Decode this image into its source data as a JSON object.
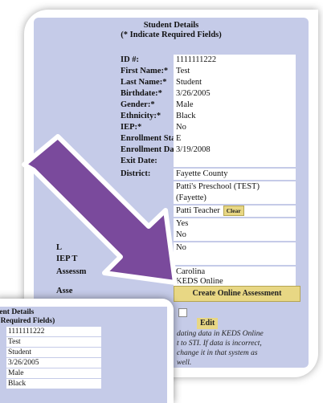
{
  "form": {
    "title": "Student Details",
    "subtitle": "(* Indicate Required Fields)",
    "rows": [
      {
        "label": "ID #:",
        "value": "1111111222"
      },
      {
        "label": "First Name:*",
        "value": "Test"
      },
      {
        "label": "Last Name:*",
        "value": "Student"
      },
      {
        "label": "Birthdate:*",
        "value": "3/26/2005"
      },
      {
        "label": "Gender:*",
        "value": "Male"
      },
      {
        "label": "Ethnicity:*",
        "value": "Black"
      },
      {
        "label": "IEP:*",
        "value": "No"
      },
      {
        "label": "Enrollment Status:*",
        "value": "E"
      },
      {
        "label": "Enrollment Date:*",
        "value": "3/19/2008"
      },
      {
        "label": "Exit Date:",
        "value": ""
      },
      {
        "label": "District:",
        "value": "Fayette County"
      },
      {
        "label": "",
        "value": "Patti's Preschool (TEST)"
      },
      {
        "label": "",
        "value": "(Fayette)"
      },
      {
        "label": "",
        "value": "Patti Teacher"
      },
      {
        "label": "",
        "value": "Yes"
      },
      {
        "label": "",
        "value": "No"
      },
      {
        "label": "L",
        "value": "No"
      },
      {
        "label": "IEP T",
        "value": ""
      },
      {
        "label": "Assessm",
        "value": "Carolina"
      },
      {
        "label": "Asse",
        "value": "KEDS Online"
      }
    ],
    "clear_label": "Clear",
    "create_label": "Create Online Assessment",
    "edit_label": "Edit",
    "note_lines": [
      "dating data in KEDS Online",
      "t to STI. If data is incorrect,",
      "change it in that system as",
      "well."
    ]
  },
  "inset": {
    "title": "dent Details",
    "subtitle": "e Required Fields)",
    "values": [
      "1111111222",
      "Test",
      "Student",
      "3/26/2005",
      "Male",
      "Black"
    ]
  },
  "colors": {
    "panel": "#c5cbe8",
    "button": "#e8d784",
    "arrow": "#7a4a9c"
  }
}
